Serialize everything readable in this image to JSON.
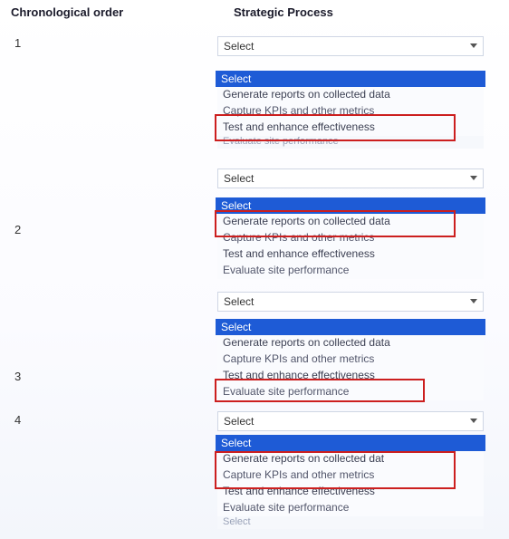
{
  "headers": {
    "left": "Chronological order",
    "right": "Strategic Process"
  },
  "numbers": {
    "n1": "1",
    "n2": "2",
    "n3": "3",
    "n4": "4"
  },
  "select_label": "Select",
  "select_header": "Select",
  "options": {
    "o1": "Generate reports on collected data",
    "o2": "Capture KPIs and other metrics",
    "o3": "Test and enhance effectiveness",
    "o4": "Evaluate site performance"
  },
  "partials": {
    "eval_site_perf_trunc": "Evaluate site performance",
    "gen_reports_cut": "Generate reports on collected dat",
    "select_cut": "Select"
  }
}
